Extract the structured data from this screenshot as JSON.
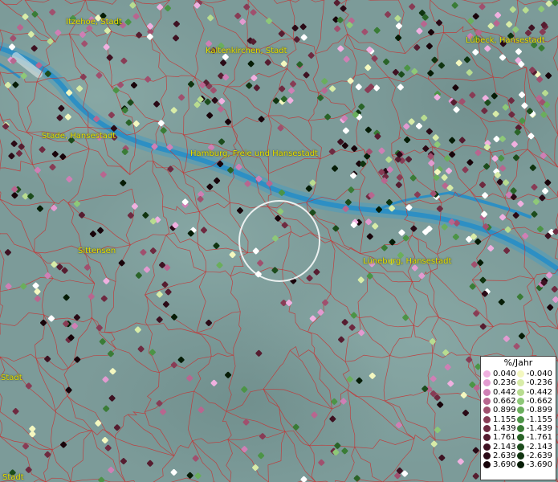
{
  "map": {
    "cities": [
      {
        "label": "Itzehoe, Stadt"
      },
      {
        "label": "Kaltenkirchen, Stadt"
      },
      {
        "label": "Lübeck, Hansestadt"
      },
      {
        "label": "Stade, Hansestadt"
      },
      {
        "label": "Hamburg, Freie und Hansestadt"
      },
      {
        "label": "Sittensen"
      },
      {
        "label": "Lüneburg, Hansestadt"
      },
      {
        "label": "Stadt"
      },
      {
        "label": "Stadt"
      }
    ],
    "colors": {
      "background": "#7a9a98",
      "river": "#3aa0c8",
      "borders": "#c83030",
      "label": "#e8e000"
    }
  },
  "legend": {
    "title": "%/Jahr",
    "positive": [
      {
        "value": "0.040",
        "color": "#f0b0e0"
      },
      {
        "value": "0.236",
        "color": "#e29ad0"
      },
      {
        "value": "0.442",
        "color": "#cf7fb5"
      },
      {
        "value": "0.662",
        "color": "#b8668f"
      },
      {
        "value": "0.899",
        "color": "#a0506e"
      },
      {
        "value": "1.155",
        "color": "#883c55"
      },
      {
        "value": "1.439",
        "color": "#6e2a40"
      },
      {
        "value": "1.761",
        "color": "#561d30"
      },
      {
        "value": "2.143",
        "color": "#3e1222"
      },
      {
        "value": "2.639",
        "color": "#2a0a16"
      },
      {
        "value": "3.690",
        "color": "#18040a"
      }
    ],
    "negative": [
      {
        "value": "-0.040",
        "color": "#f4f8c0"
      },
      {
        "value": "-0.236",
        "color": "#d8eca8"
      },
      {
        "value": "-0.442",
        "color": "#b8dc90"
      },
      {
        "value": "-0.662",
        "color": "#8ec878"
      },
      {
        "value": "-0.899",
        "color": "#6aae5c"
      },
      {
        "value": "-1.155",
        "color": "#4c9446"
      },
      {
        "value": "-1.439",
        "color": "#3a7c36"
      },
      {
        "value": "-1.761",
        "color": "#2a6428"
      },
      {
        "value": "-2.143",
        "color": "#1c4c1c"
      },
      {
        "value": "-2.639",
        "color": "#103410"
      },
      {
        "value": "-3.690",
        "color": "#061c06"
      }
    ]
  }
}
